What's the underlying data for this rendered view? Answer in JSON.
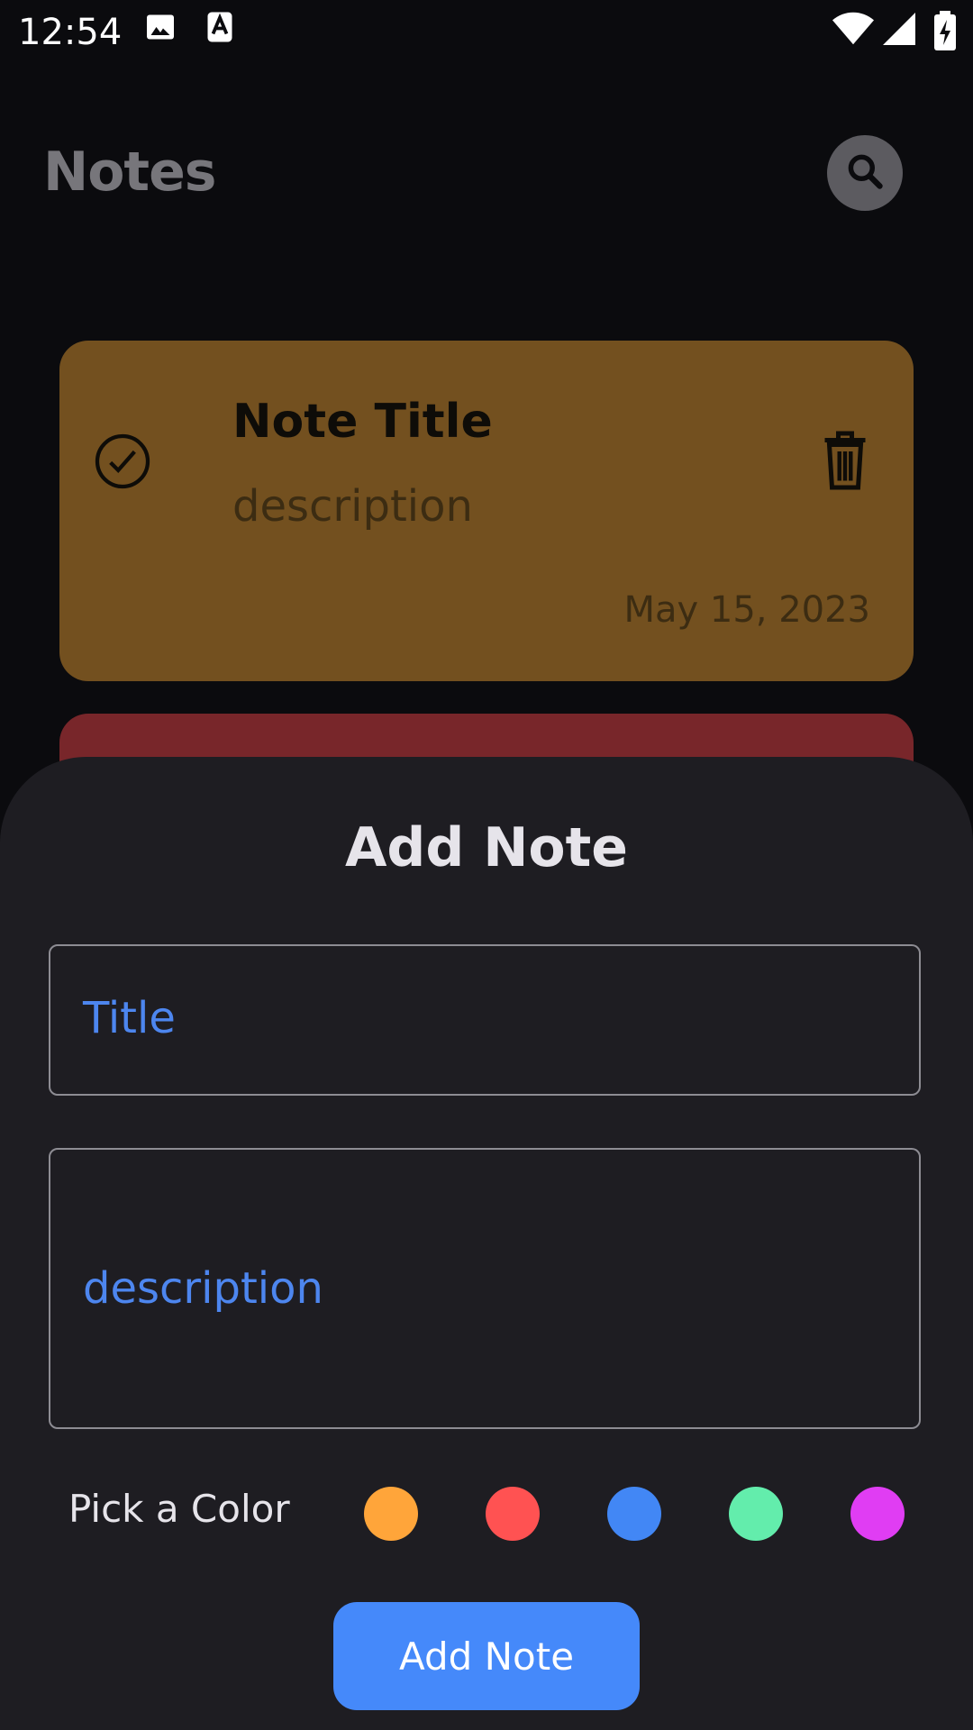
{
  "status_bar": {
    "time": "12:54",
    "icons": [
      "image-icon",
      "a-keyboard-icon",
      "wifi-icon",
      "signal-icon",
      "battery-charging-icon"
    ]
  },
  "header": {
    "title": "Notes",
    "search_icon": "search-icon"
  },
  "notes": [
    {
      "title": "Note Title",
      "description": "description",
      "date": "May 15, 2023",
      "color": "#73501f",
      "icons": [
        "check-circle-icon",
        "trash-icon"
      ]
    },
    {
      "color": "#78262a"
    }
  ],
  "sheet": {
    "title": "Add Note",
    "title_placeholder": "Title",
    "description_placeholder": "description",
    "pick_color_label": "Pick a Color",
    "colors": [
      "#ffa53a",
      "#ff5252",
      "#4287f5",
      "#63edac",
      "#e03df3"
    ],
    "submit_label": "Add Note"
  },
  "colors": {
    "background": "#0b0b0e",
    "sheet": "#1e1d22",
    "accent": "#4589fa",
    "placeholder": "#4d86ef"
  }
}
